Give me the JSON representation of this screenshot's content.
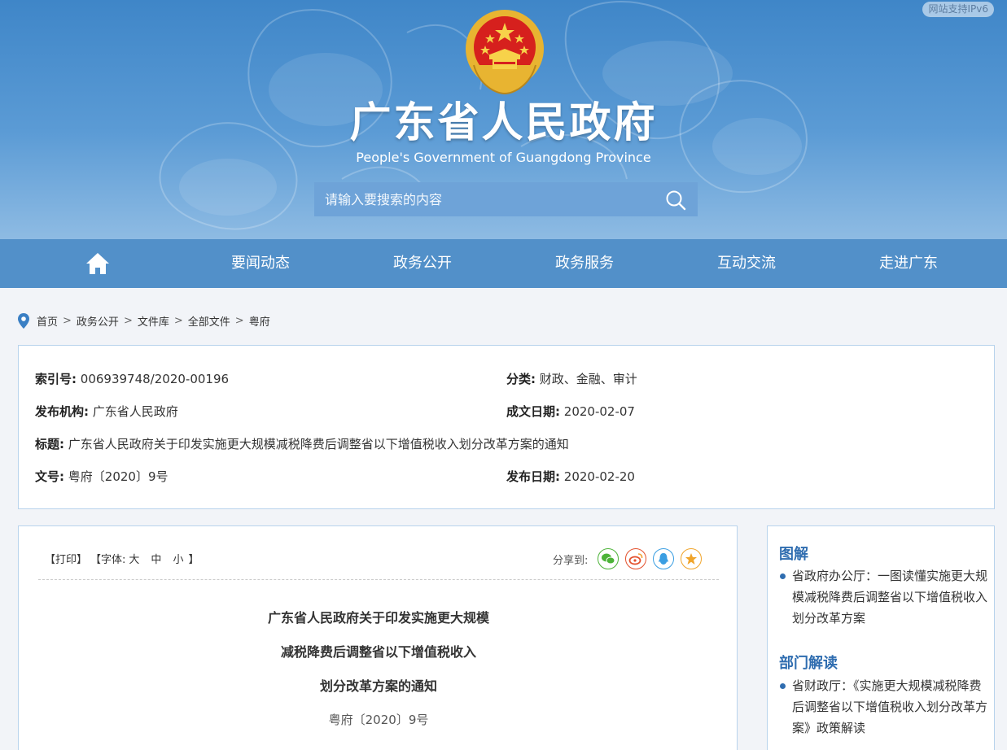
{
  "header": {
    "ipv6_badge": "网站支持IPv6",
    "title": "广东省人民政府",
    "subtitle": "People's Government of Guangdong Province",
    "search_placeholder": "请输入要搜索的内容"
  },
  "nav": {
    "items": [
      "要闻动态",
      "政务公开",
      "政务服务",
      "互动交流",
      "走进广东"
    ]
  },
  "breadcrumb": [
    "首页",
    "政务公开",
    "文件库",
    "全部文件",
    "粤府"
  ],
  "info": {
    "index_label": "索引号:",
    "index_value": "006939748/2020-00196",
    "category_label": "分类:",
    "category_value": "财政、金融、审计",
    "publisher_label": "发布机构:",
    "publisher_value": "广东省人民政府",
    "written_label": "成文日期:",
    "written_value": "2020-02-07",
    "title_label": "标题:",
    "title_value": "广东省人民政府关于印发实施更大规模减税降费后调整省以下增值税收入划分改革方案的通知",
    "docno_label": "文号:",
    "docno_value": "粤府〔2020〕9号",
    "published_label": "发布日期:",
    "published_value": "2020-02-20"
  },
  "article": {
    "print": "【打印】",
    "font_label": "【字体:",
    "font_large": "大",
    "font_medium": "中",
    "font_small": "小",
    "font_close": "】",
    "share_label": "分享到:",
    "title_lines": [
      "广东省人民政府关于印发实施更大规模",
      "减税降费后调整省以下增值税收入",
      "划分改革方案的通知"
    ],
    "doc_number": "粤府〔2020〕9号"
  },
  "sidebar": {
    "section1_title": "图解",
    "section1_item": "省政府办公厅：一图读懂实施更大规模减税降费后调整省以下增值税收入划分改革方案",
    "section2_title": "部门解读",
    "section2_item": "省财政厅：《实施更大规模减税降费后调整省以下增值税收入划分改革方案》政策解读"
  },
  "colors": {
    "nav": "#5290c9",
    "accent": "#2f6db0",
    "border": "#b8d3ec"
  }
}
